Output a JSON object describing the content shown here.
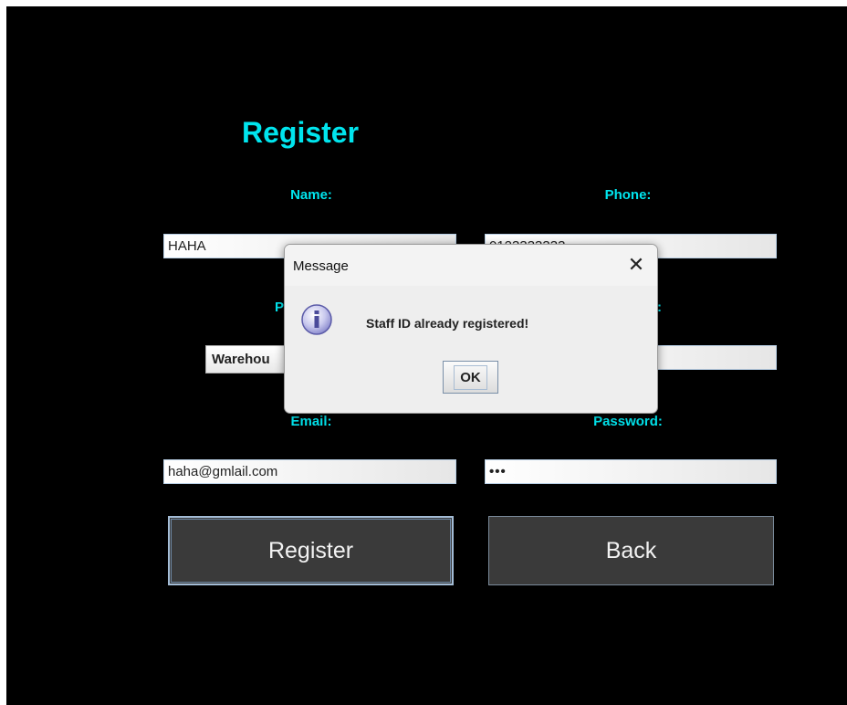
{
  "form": {
    "title": "Register",
    "labels": {
      "name": "Name:",
      "phone": "Phone:",
      "position": "P",
      "staff_id_tail": ":",
      "email": "Email:",
      "password": "Password:"
    },
    "values": {
      "name": "HAHA",
      "phone": "0123333333",
      "position": "Warehou",
      "staff_id": "",
      "email": "haha@gmlail.com",
      "password": "•••"
    },
    "buttons": {
      "register": "Register",
      "back": "Back"
    }
  },
  "dialog": {
    "title": "Message",
    "close_glyph": "✕",
    "icon": "info-icon",
    "message": "Staff ID already registered!",
    "ok_label": "OK"
  },
  "colors": {
    "background": "#000000",
    "accent": "#00e5ee",
    "button_bg": "#3a3a3a"
  }
}
